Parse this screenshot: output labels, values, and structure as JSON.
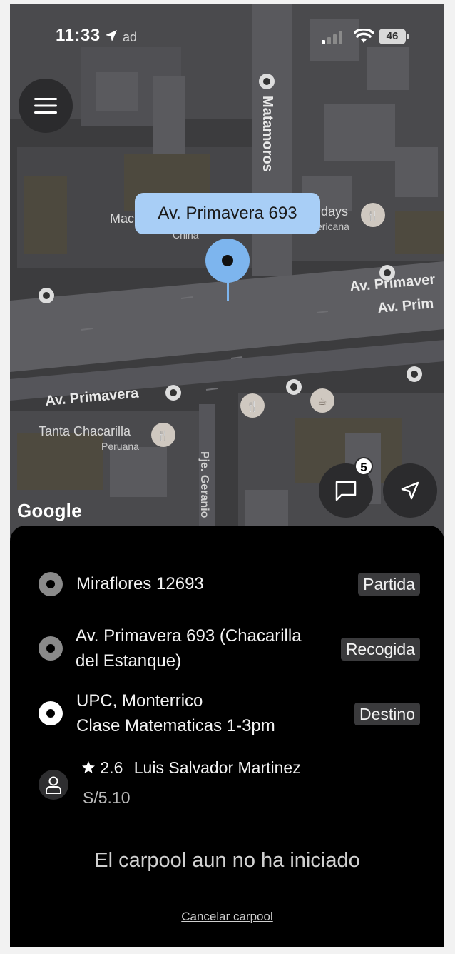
{
  "status_bar": {
    "time": "11:33",
    "battery": "46"
  },
  "map": {
    "pin_label": "Av. Primavera 693",
    "street_labels": {
      "matamoros": "Matamoros",
      "av_primavera_left": "Av. Primavera",
      "av_primavera_right_1": "Av. Primaver",
      "av_primavera_right_2": "Av. Prim",
      "pje_geranio": "Pje. Geranio"
    },
    "poi_labels": {
      "tanta": "Tanta Chacarilla",
      "tanta_sub": "Peruana",
      "fridays": "idays",
      "fridays_sub": "ericana",
      "mac": "Mac",
      "china": "China",
      "top_left": "ad"
    },
    "google_logo": "Google",
    "chat_badge": "5"
  },
  "trip": {
    "stops": [
      {
        "text_line1": "Miraflores 12693",
        "text_line2": "",
        "tag": "Partida"
      },
      {
        "text_line1": "Av. Primavera 693 (Chacarilla",
        "text_line2": "del Estanque)",
        "tag": "Recogida"
      },
      {
        "text_line1": "UPC, Monterrico",
        "text_line2": "Clase Matematicas 1-3pm",
        "tag": "Destino"
      }
    ],
    "driver": {
      "rating": "2.6",
      "name": "Luis Salvador Martinez",
      "price": "S/5.10"
    },
    "status_message": "El carpool aun no ha iniciado",
    "cancel_label": "Cancelar carpool"
  },
  "colors": {
    "pin": "#7db5ee",
    "pin_label_bg": "#a8cef6",
    "sheet_bg": "#000000",
    "tag_bg": "#3a3a3c"
  }
}
